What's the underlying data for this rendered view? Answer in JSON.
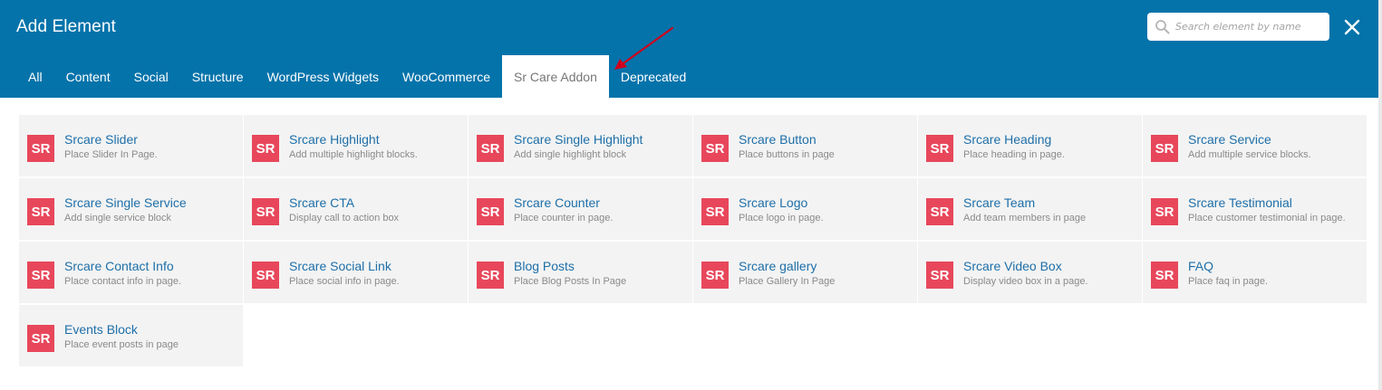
{
  "header": {
    "title": "Add Element",
    "search_placeholder": "Search element by name"
  },
  "tabs": [
    {
      "label": "All",
      "active": false
    },
    {
      "label": "Content",
      "active": false
    },
    {
      "label": "Social",
      "active": false
    },
    {
      "label": "Structure",
      "active": false
    },
    {
      "label": "WordPress Widgets",
      "active": false
    },
    {
      "label": "WooCommerce",
      "active": false
    },
    {
      "label": "Sr Care Addon",
      "active": true
    },
    {
      "label": "Deprecated",
      "active": false
    }
  ],
  "elements": [
    {
      "badge": "SR",
      "title": "Srcare Slider",
      "desc": "Place Slider In Page."
    },
    {
      "badge": "SR",
      "title": "Srcare Highlight",
      "desc": "Add multiple highlight blocks."
    },
    {
      "badge": "SR",
      "title": "Srcare Single Highlight",
      "desc": "Add single highlight block"
    },
    {
      "badge": "SR",
      "title": "Srcare Button",
      "desc": "Place buttons in page"
    },
    {
      "badge": "SR",
      "title": "Srcare Heading",
      "desc": "Place heading in page."
    },
    {
      "badge": "SR",
      "title": "Srcare Service",
      "desc": "Add multiple service blocks."
    },
    {
      "badge": "SR",
      "title": "Srcare Single Service",
      "desc": "Add single service block"
    },
    {
      "badge": "SR",
      "title": "Srcare CTA",
      "desc": "Display call to action box"
    },
    {
      "badge": "SR",
      "title": "Srcare Counter",
      "desc": "Place counter in page."
    },
    {
      "badge": "SR",
      "title": "Srcare Logo",
      "desc": "Place logo in page."
    },
    {
      "badge": "SR",
      "title": "Srcare Team",
      "desc": "Add team members in page"
    },
    {
      "badge": "SR",
      "title": "Srcare Testimonial",
      "desc": "Place customer testimonial in page."
    },
    {
      "badge": "SR",
      "title": "Srcare Contact Info",
      "desc": "Place contact info in page."
    },
    {
      "badge": "SR",
      "title": "Srcare Social Link",
      "desc": "Place social info in page."
    },
    {
      "badge": "SR",
      "title": "Blog Posts",
      "desc": "Place Blog Posts In Page"
    },
    {
      "badge": "SR",
      "title": "Srcare gallery",
      "desc": "Place Gallery In Page"
    },
    {
      "badge": "SR",
      "title": "Srcare Video Box",
      "desc": "Display video box in a page."
    },
    {
      "badge": "SR",
      "title": "FAQ",
      "desc": "Place faq in page."
    },
    {
      "badge": "SR",
      "title": "Events Block",
      "desc": "Place event posts in page"
    }
  ],
  "icons": {
    "search": "search-icon",
    "close": "close-icon",
    "annotation": "red-arrow-annotation"
  },
  "colors": {
    "header_bg": "#0473aa",
    "badge_bg": "#e8475b",
    "title_link": "#1e6fa8",
    "arrow": "#d0021b"
  }
}
